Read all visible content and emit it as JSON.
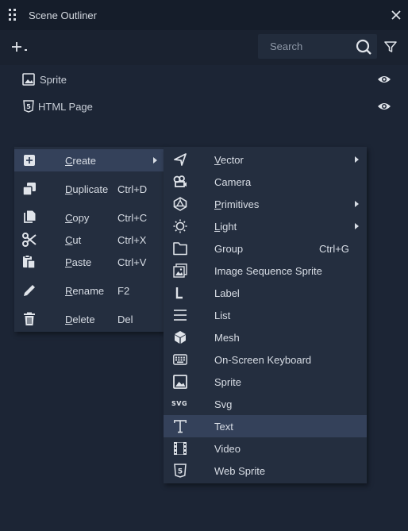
{
  "panel": {
    "title": "Scene Outliner",
    "icons": {
      "drag": "drag-handle-icon",
      "close": "close-icon"
    }
  },
  "toolbar": {
    "add_icon": "plus-dropdown-icon",
    "search_placeholder": "Search",
    "search_value": "",
    "search_icon": "search-icon",
    "filter_icon": "filter-icon"
  },
  "tree": {
    "items": [
      {
        "label": "Sprite",
        "icon": "image-icon",
        "visible_icon": "eye-icon"
      },
      {
        "label": "HTML Page",
        "icon": "html5-icon",
        "visible_icon": "eye-icon"
      }
    ]
  },
  "context_menu": {
    "items": [
      {
        "label": "Create",
        "shortcut": "",
        "icon": "plus-box-icon",
        "submenu": true,
        "active": true
      },
      {
        "label": "Duplicate",
        "shortcut": "Ctrl+D",
        "icon": "duplicate-icon"
      },
      {
        "label": "Copy",
        "shortcut": "Ctrl+C",
        "icon": "copy-icon"
      },
      {
        "label": "Cut",
        "shortcut": "Ctrl+X",
        "icon": "scissors-icon"
      },
      {
        "label": "Paste",
        "shortcut": "Ctrl+V",
        "icon": "paste-icon"
      },
      {
        "label": "Rename",
        "shortcut": "F2",
        "icon": "pencil-icon"
      },
      {
        "label": "Delete",
        "shortcut": "Del",
        "icon": "trash-icon"
      }
    ]
  },
  "create_submenu": {
    "items": [
      {
        "label": "Vector",
        "icon": "vector-icon",
        "submenu": true,
        "underline": true
      },
      {
        "label": "Camera",
        "icon": "camera-icon"
      },
      {
        "label": "Primitives",
        "icon": "primitives-icon",
        "submenu": true,
        "underline": true
      },
      {
        "label": "Light",
        "icon": "light-icon",
        "submenu": true,
        "underline": true
      },
      {
        "label": "Group",
        "icon": "folder-icon",
        "shortcut": "Ctrl+G"
      },
      {
        "label": "Image Sequence Sprite",
        "icon": "image-sequence-icon"
      },
      {
        "label": "Label",
        "icon": "label-icon"
      },
      {
        "label": "List",
        "icon": "list-icon"
      },
      {
        "label": "Mesh",
        "icon": "mesh-cube-icon"
      },
      {
        "label": "On-Screen Keyboard",
        "icon": "keyboard-icon"
      },
      {
        "label": "Sprite",
        "icon": "image-icon"
      },
      {
        "label": "Svg",
        "icon": "svg-icon",
        "icon_text": "SVG"
      },
      {
        "label": "Text",
        "icon": "text-icon",
        "active": true
      },
      {
        "label": "Video",
        "icon": "video-icon"
      },
      {
        "label": "Web Sprite",
        "icon": "html5-icon"
      }
    ]
  },
  "colors": {
    "background": "#1c2535",
    "titlebar": "#151d2a",
    "menu": "#242e3f",
    "menu_highlight": "#34415a",
    "text": "#d8dde5"
  }
}
